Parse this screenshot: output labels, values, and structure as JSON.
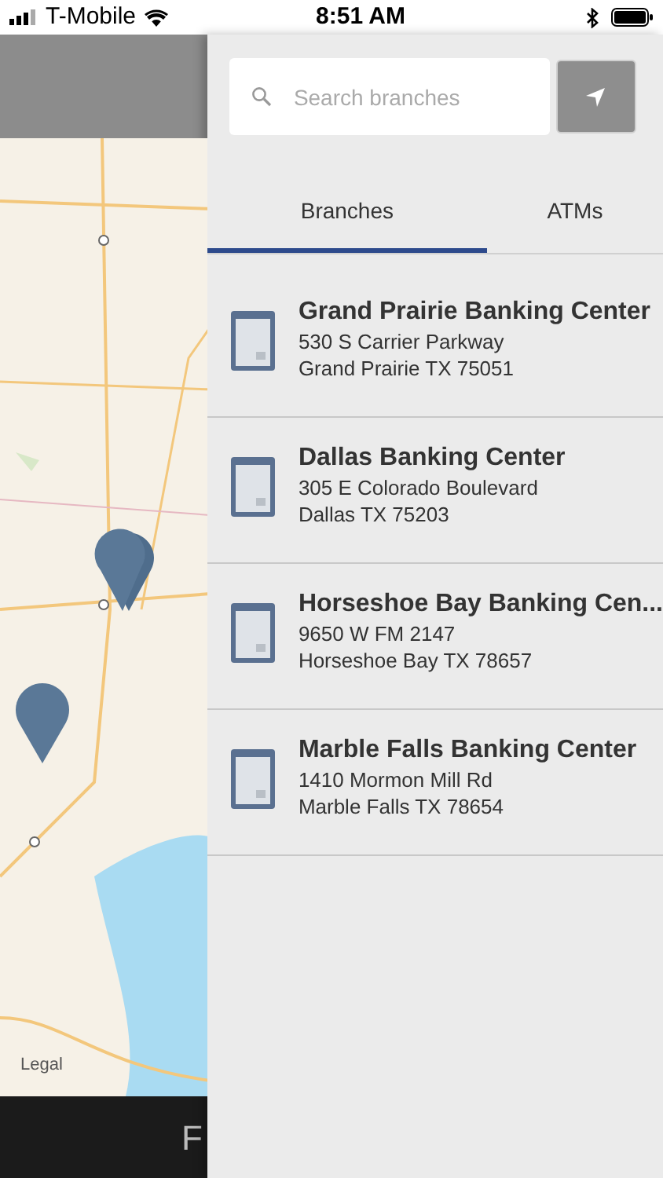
{
  "status_bar": {
    "carrier": "T-Mobile",
    "time": "8:51 AM"
  },
  "map": {
    "legal_link": "Legal"
  },
  "bottom_bar": {
    "text": "F"
  },
  "search": {
    "placeholder": "Search branches"
  },
  "tabs": [
    {
      "label": "Branches",
      "selected": true
    },
    {
      "label": "ATMs",
      "selected": false
    }
  ],
  "branches": [
    {
      "name": "Grand Prairie Banking Center",
      "address": "530 S Carrier Parkway",
      "city": "Grand Prairie TX 75051"
    },
    {
      "name": "Dallas Banking Center",
      "address": "305 E Colorado Boulevard",
      "city": "Dallas TX 75203"
    },
    {
      "name": "Horseshoe Bay Banking Cen...",
      "address": "9650 W FM 2147",
      "city": "Horseshoe Bay TX 78657"
    },
    {
      "name": "Marble Falls Banking Center",
      "address": "1410 Mormon Mill Rd",
      "city": "Marble Falls TX 78654"
    }
  ]
}
